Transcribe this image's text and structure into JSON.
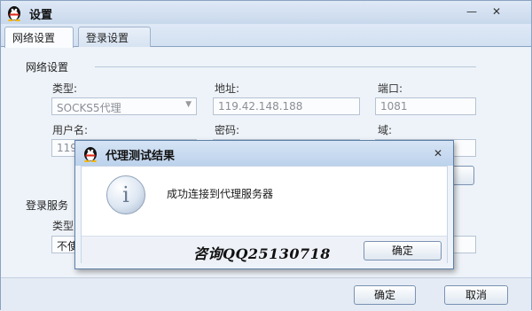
{
  "window": {
    "title": "设置",
    "minimize": "—",
    "close": "✕"
  },
  "tabs": [
    {
      "label": "网络设置"
    },
    {
      "label": "登录设置"
    }
  ],
  "network": {
    "group_label": "网络设置",
    "type_label": "类型:",
    "type_value": "SOCKS5代理",
    "address_label": "地址:",
    "address_value": "119.42.148.188",
    "port_label": "端口:",
    "port_value": "1081",
    "username_label": "用户名:",
    "username_value": "119",
    "password_label": "密码:",
    "domain_label": "域:"
  },
  "login_server": {
    "group_label": "登录服务",
    "type_label": "类型",
    "type_value": "不使"
  },
  "footer": {
    "ok_label": "确定",
    "cancel_label": "取消"
  },
  "dialog": {
    "title": "代理测试结果",
    "close": "✕",
    "icon_glyph": "i",
    "message": "成功连接到代理服务器",
    "ok_label": "确定"
  },
  "watermark": "咨询QQ25130718",
  "colors": {
    "titlebar": "#c8d8ec",
    "window_bg": "#eef3f9",
    "dialog_body": "#ffffff",
    "border": "#8aa3c2"
  },
  "icons": {
    "app": "qq-penguin-icon",
    "info": "info-icon",
    "dropdown": "chevron-down-icon"
  }
}
